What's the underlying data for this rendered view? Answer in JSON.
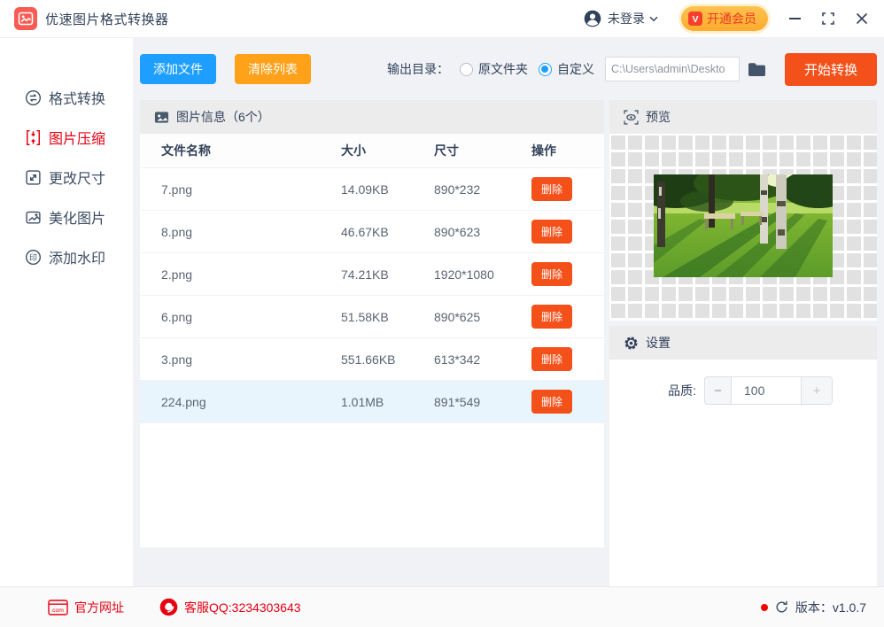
{
  "colors": {
    "brand_red": "#f85a54",
    "accent_blue": "#1e9fff",
    "accent_orange": "#ffa119",
    "action_orange_red": "#f3501a",
    "active_red": "#e60012",
    "selected_row_bg": "#e9f5fd",
    "panel_band_bg": "#ececec",
    "main_bg": "#f0f2f5"
  },
  "titlebar": {
    "app_title": "优速图片格式转换器",
    "login_label": "未登录",
    "vip_label": "开通会员",
    "vip_badge_text": "V"
  },
  "toolbar": {
    "add_files_label": "添加文件",
    "clear_list_label": "清除列表",
    "output_dir_label": "输出目录：",
    "radio_original_label": "原文件夹",
    "radio_custom_label": "自定义",
    "radio_selected": "自定义",
    "path_value": "C:\\Users\\admin\\Deskto",
    "start_convert_label": "开始转换"
  },
  "sidebar": {
    "items": [
      {
        "label": "格式转换",
        "active": false
      },
      {
        "label": "图片压缩",
        "active": true
      },
      {
        "label": "更改尺寸",
        "active": false
      },
      {
        "label": "美化图片",
        "active": false
      },
      {
        "label": "添加水印",
        "active": false
      }
    ]
  },
  "table": {
    "section_title": "图片信息（6个）",
    "columns": [
      "文件名称",
      "大小",
      "尺寸",
      "操作"
    ],
    "delete_label": "删除",
    "rows": [
      {
        "name": "7.png",
        "size": "14.09KB",
        "dimensions": "890*232",
        "selected": false
      },
      {
        "name": "8.png",
        "size": "46.67KB",
        "dimensions": "890*623",
        "selected": false
      },
      {
        "name": "2.png",
        "size": "74.21KB",
        "dimensions": "1920*1080",
        "selected": false
      },
      {
        "name": "6.png",
        "size": "51.58KB",
        "dimensions": "890*625",
        "selected": false
      },
      {
        "name": "3.png",
        "size": "551.66KB",
        "dimensions": "613*342",
        "selected": false
      },
      {
        "name": "224.png",
        "size": "1.01MB",
        "dimensions": "891*549",
        "selected": true
      }
    ]
  },
  "preview": {
    "section_title": "预览"
  },
  "settings": {
    "section_title": "设置",
    "quality_label": "品质:",
    "quality_value": "100",
    "minus_label": "−",
    "plus_label": "+"
  },
  "footer": {
    "website_label": "官方网址",
    "website_icon_text": ".com",
    "qq_label": "客服QQ:3234303643",
    "version_label": "版本：v1.0.7"
  },
  "icons": {
    "watermark_glyph": "印"
  }
}
